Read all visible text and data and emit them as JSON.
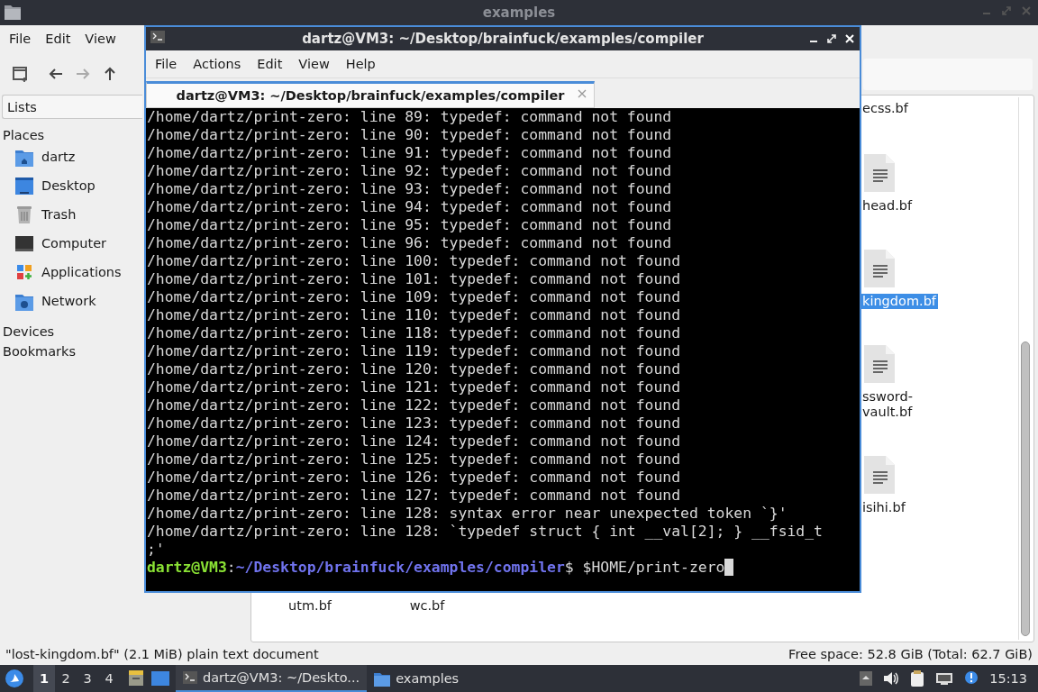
{
  "file_manager": {
    "title": "examples",
    "menu": [
      "File",
      "Edit",
      "View"
    ],
    "sidebar": {
      "combo": "Lists",
      "sections": [
        {
          "title": "Places",
          "items": [
            {
              "label": "dartz"
            },
            {
              "label": "Desktop"
            },
            {
              "label": "Trash"
            },
            {
              "label": "Computer"
            },
            {
              "label": "Applications"
            },
            {
              "label": "Network"
            }
          ]
        },
        {
          "title": "Devices"
        },
        {
          "title": "Bookmarks"
        }
      ]
    },
    "files": [
      {
        "name": "ecss.bf",
        "selected": false
      },
      {
        "name": "head.bf",
        "selected": false
      },
      {
        "name": "kingdom.bf",
        "selected": true
      },
      {
        "name": "ssword-\nvault.bf",
        "selected": false
      },
      {
        "name": "isihi.bf",
        "selected": false
      }
    ],
    "bottom_files": [
      {
        "name": "utm.bf",
        "selected": false
      },
      {
        "name": "wc.bf",
        "selected": false
      }
    ],
    "status_bar": {
      "left": "\"lost-kingdom.bf\" (2.1 MiB) plain text document",
      "right": "Free space: 52.8 GiB (Total: 62.7 GiB)"
    }
  },
  "terminal": {
    "title": "dartz@VM3: ~/Desktop/brainfuck/examples/compiler",
    "menu": [
      "File",
      "Actions",
      "Edit",
      "View",
      "Help"
    ],
    "tab": {
      "label": "dartz@VM3: ~/Desktop/brainfuck/examples/compiler",
      "selected": true
    },
    "lines": [
      "/home/dartz/print-zero: line 89: typedef: command not found",
      "/home/dartz/print-zero: line 90: typedef: command not found",
      "/home/dartz/print-zero: line 91: typedef: command not found",
      "/home/dartz/print-zero: line 92: typedef: command not found",
      "/home/dartz/print-zero: line 93: typedef: command not found",
      "/home/dartz/print-zero: line 94: typedef: command not found",
      "/home/dartz/print-zero: line 95: typedef: command not found",
      "/home/dartz/print-zero: line 96: typedef: command not found",
      "/home/dartz/print-zero: line 100: typedef: command not found",
      "/home/dartz/print-zero: line 101: typedef: command not found",
      "/home/dartz/print-zero: line 109: typedef: command not found",
      "/home/dartz/print-zero: line 110: typedef: command not found",
      "/home/dartz/print-zero: line 118: typedef: command not found",
      "/home/dartz/print-zero: line 119: typedef: command not found",
      "/home/dartz/print-zero: line 120: typedef: command not found",
      "/home/dartz/print-zero: line 121: typedef: command not found",
      "/home/dartz/print-zero: line 122: typedef: command not found",
      "/home/dartz/print-zero: line 123: typedef: command not found",
      "/home/dartz/print-zero: line 124: typedef: command not found",
      "/home/dartz/print-zero: line 125: typedef: command not found",
      "/home/dartz/print-zero: line 126: typedef: command not found",
      "/home/dartz/print-zero: line 127: typedef: command not found",
      "/home/dartz/print-zero: line 128: syntax error near unexpected token `}'",
      "/home/dartz/print-zero: line 128: `typedef struct { int __val[2]; } __fsid_t",
      ";'"
    ],
    "prompt": {
      "user_host": "dartz@VM3",
      "separator": ":",
      "path": "~/Desktop/brainfuck/examples/compiler",
      "symbol": "$",
      "command": "$HOME/print-zero"
    }
  },
  "taskbar": {
    "workspaces": [
      {
        "label": "1",
        "selected": true
      },
      {
        "label": "2",
        "selected": false
      },
      {
        "label": "3",
        "selected": false
      },
      {
        "label": "4",
        "selected": false
      }
    ],
    "tasks": [
      {
        "label": "dartz@VM3: ~/Deskto...",
        "active": true
      },
      {
        "label": "examples",
        "active": false
      }
    ],
    "clock": "15:13"
  }
}
